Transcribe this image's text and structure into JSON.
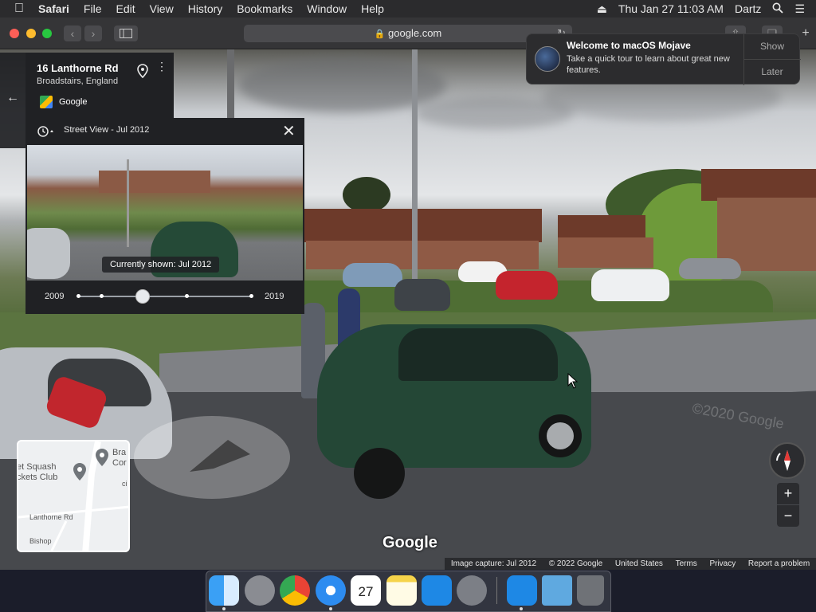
{
  "menubar": {
    "app": "Safari",
    "items": [
      "File",
      "Edit",
      "View",
      "History",
      "Bookmarks",
      "Window",
      "Help"
    ],
    "clock": "Thu Jan 27  11:03 AM",
    "user": "Dartz"
  },
  "toolbar": {
    "url": "google.com"
  },
  "place": {
    "title": "16 Lanthorne Rd",
    "subtitle": "Broadstairs, England",
    "source": "Google"
  },
  "streetview": {
    "header": "Street View - Jul 2012",
    "current_label": "Currently shown: Jul 2012",
    "year_start": "2009",
    "year_end": "2019",
    "slider_value": 0.37
  },
  "minimap": {
    "poi1": "et Squash\nckets Club",
    "poi2": "Bra\nCor",
    "road1": "Lanthorne Rd",
    "road2": "Bishop",
    "road3": "ci"
  },
  "notification": {
    "title": "Welcome to macOS Mojave",
    "body": "Take a quick tour to learn about great new features.",
    "show": "Show",
    "later": "Later"
  },
  "watermark": "©2020 Google",
  "logo": "Google",
  "footer": {
    "capture": "Image capture: Jul 2012",
    "copyright": "© 2022 Google",
    "country": "United States",
    "terms": "Terms",
    "privacy": "Privacy",
    "report": "Report a problem"
  },
  "zoom": {
    "plus": "+",
    "minus": "−"
  },
  "colors": {
    "accent": "#1a73e8",
    "panel": "#202124"
  }
}
